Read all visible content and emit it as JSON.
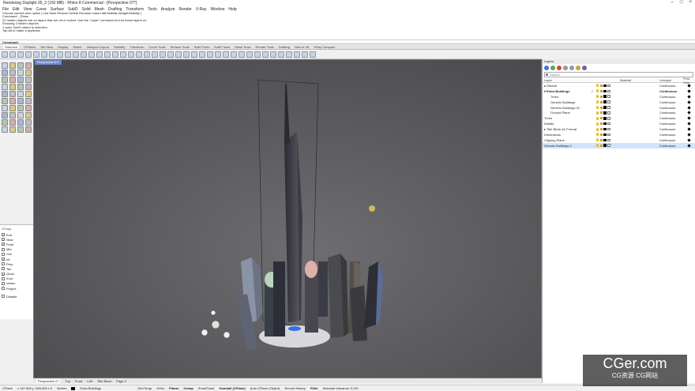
{
  "window": {
    "title": "Rendering Daylight 35_2 (150 MB) - Rhino 8 Commercial - [Perspective 07*]"
  },
  "menu": [
    "File",
    "Edit",
    "View",
    "Curve",
    "Surface",
    "SubD",
    "Solid",
    "Mesh",
    "Drafting",
    "Transform",
    "Tools",
    "Analyze",
    "Render",
    "V-Ray",
    "Window",
    "Help"
  ],
  "command_history": [
    "Choose named view option ( List  Save  Restore  Delete  Rename  Import  tabVisibility  WidgetVisibility )",
    "Command: _Show",
    "22 hidden objects are on layers that are off or locked.  Use the \"Layer\" command to turn these layers on.",
    "Showing 3 hidden objects.",
    "1 open SubD added to selection",
    "Tap Alt to make a duplicate"
  ],
  "command_prompt": "Command:",
  "toolbar_tabs": [
    "Standard",
    "CPlanes",
    "Set View",
    "Display",
    "Select",
    "Viewport Layout",
    "Visibility",
    "Transform",
    "Curve Tools",
    "Surface Tools",
    "Solid Tools",
    "SubD Tools",
    "Mesh Tools",
    "Render Tools",
    "Drafting",
    "New in V8",
    "VRay Compact"
  ],
  "viewport": {
    "title": "Perspective 07*",
    "tabs": [
      "Perspective 07",
      "Top",
      "Front",
      "Left",
      "Title Block",
      "Page 2"
    ]
  },
  "osnap": {
    "header": "OSnap",
    "items": [
      {
        "label": "End",
        "checked": true
      },
      {
        "label": "Near",
        "checked": true
      },
      {
        "label": "Point",
        "checked": true
      },
      {
        "label": "Mid",
        "checked": false
      },
      {
        "label": "Cen",
        "checked": false
      },
      {
        "label": "Int",
        "checked": true
      },
      {
        "label": "Perp",
        "checked": false
      },
      {
        "label": "Tan",
        "checked": false
      },
      {
        "label": "Quad",
        "checked": true
      },
      {
        "label": "Knot",
        "checked": false
      },
      {
        "label": "Vertex",
        "checked": false
      },
      {
        "label": "Project",
        "checked": false
      },
      {
        "label": "Disable",
        "checked": false
      }
    ]
  },
  "layers_panel": {
    "title": "Layers",
    "search_placeholder": "Search",
    "columns": {
      "layer": "Layer",
      "material": "Material",
      "linetype": "Linetype",
      "print": "Print Colo"
    },
    "rows": [
      {
        "name": "Default",
        "indent": 0,
        "prefix": "▸",
        "current": false,
        "bold": false,
        "linetype": "Continuous",
        "selected": false
      },
      {
        "name": "Extra Buildings",
        "indent": 0,
        "prefix": "▾",
        "current": true,
        "bold": true,
        "linetype": "Continuous",
        "selected": false
      },
      {
        "name": "Trees",
        "indent": 2,
        "prefix": "",
        "current": false,
        "bold": false,
        "linetype": "Continuous",
        "selected": false
      },
      {
        "name": "Generic Buildings",
        "indent": 2,
        "prefix": "",
        "current": false,
        "bold": false,
        "linetype": "Continuous",
        "selected": false
      },
      {
        "name": "Generic Buildings 02",
        "indent": 2,
        "prefix": "",
        "current": false,
        "bold": false,
        "linetype": "Continuous",
        "selected": false
      },
      {
        "name": "Ground Plane",
        "indent": 2,
        "prefix": "",
        "current": false,
        "bold": false,
        "linetype": "Continuous",
        "selected": false
      },
      {
        "name": "Trees",
        "indent": 0,
        "prefix": "",
        "current": false,
        "bold": false,
        "linetype": "Continuous",
        "selected": false
      },
      {
        "name": "Details",
        "indent": 0,
        "prefix": "",
        "current": false,
        "bold": false,
        "linetype": "Continuous",
        "selected": false
      },
      {
        "name": "Title Block A2 Format",
        "indent": 0,
        "prefix": "▸",
        "current": false,
        "bold": false,
        "linetype": "Continuous",
        "selected": false
      },
      {
        "name": "Dimensions",
        "indent": 0,
        "prefix": "",
        "current": false,
        "bold": false,
        "linetype": "Continuous",
        "selected": false
      },
      {
        "name": "Clipping Plane",
        "indent": 0,
        "prefix": "",
        "current": false,
        "bold": false,
        "linetype": "Continuous",
        "selected": false
      },
      {
        "name": "Generic Buildings 2",
        "indent": 0,
        "prefix": "",
        "current": false,
        "bold": false,
        "linetype": "Continuous",
        "selected": true
      }
    ]
  },
  "status": {
    "cplane": "CPlane",
    "coords": "x 167.669  y -665.606  z 0",
    "units": "Meters",
    "layer": "Extra Buildings",
    "toggles": [
      "Grid Snap",
      "Ortho",
      "Planar",
      "Osnap",
      "SmartTrack",
      "Gumball (CPlane)",
      "Auto CPlane (Object)",
      "Record History",
      "Filter"
    ],
    "tolerance": "Absolute tolerance: 0.001"
  },
  "watermark": {
    "main": "CGer.com",
    "sub": "CG资源  CG网站"
  }
}
